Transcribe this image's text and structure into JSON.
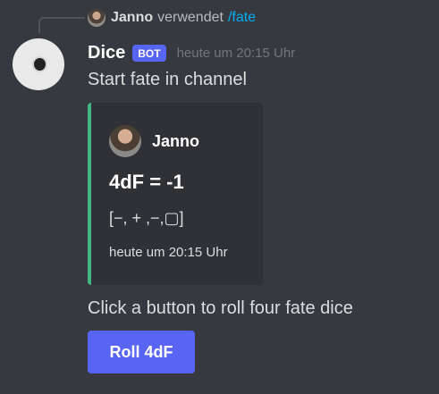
{
  "reply": {
    "user": "Janno",
    "text": "verwendet",
    "command": "/fate"
  },
  "message": {
    "author": "Dice",
    "bot_tag": "BOT",
    "timestamp": "heute um 20:15 Uhr",
    "content": "Start fate in channel"
  },
  "embed": {
    "author": "Janno",
    "title": "4dF = -1",
    "description": "[−, + ,−,▢]",
    "footer": "heute um 20:15 Uhr"
  },
  "components": {
    "helper_text": "Click a button to roll four fate dice",
    "button_label": "Roll 4dF"
  },
  "colors": {
    "background": "#36393f",
    "embed_background": "#2f3136",
    "embed_accent": "#43b581",
    "link": "#00aff4",
    "button": "#5865f2"
  }
}
